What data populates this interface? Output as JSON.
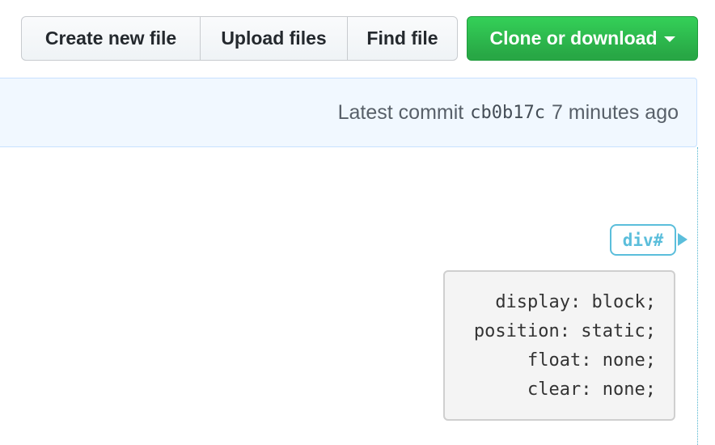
{
  "toolbar": {
    "create_new_file": "Create new file",
    "upload_files": "Upload files",
    "find_file": "Find file",
    "clone_or_download": "Clone or download"
  },
  "commit": {
    "prefix": "Latest commit",
    "sha": "cb0b17c",
    "time": "7 minutes ago"
  },
  "inspector": {
    "tag_label": "div#",
    "accent_color": "#5bbedb",
    "styles": [
      "display: block;",
      "position: static;",
      "float: none;",
      "clear: none;"
    ]
  },
  "colors": {
    "clone_button": "#28a745",
    "commit_bar_bg": "#f1f8ff"
  }
}
